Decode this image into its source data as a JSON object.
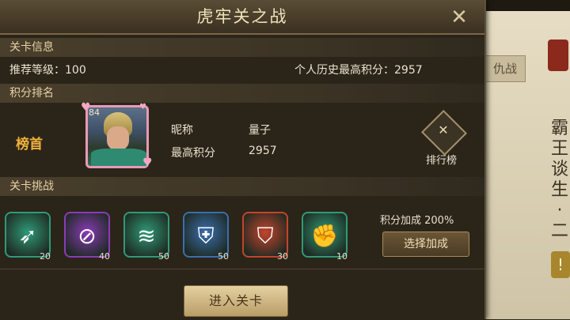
{
  "dialog": {
    "title": "虎牢关之战",
    "close_label": "✕"
  },
  "level_info": {
    "header": "关卡信息",
    "recommended_label": "推荐等级：",
    "recommended_value": "100",
    "personal_best_label": "个人历史最高积分：",
    "personal_best_value": "2957"
  },
  "ranking": {
    "header": "积分排名",
    "top_badge": "榜首",
    "portrait_level": "84",
    "nickname_label": "昵称",
    "nickname_value": "量子",
    "best_label": "最高积分",
    "best_value": "2957",
    "leaderboard_label": "排行榜"
  },
  "challenge": {
    "header": "关卡挑战",
    "skills": [
      {
        "icon": "horn-icon",
        "glyph": "➶",
        "count": "20",
        "color": "#2f9a78"
      },
      {
        "icon": "ban-fire-icon",
        "glyph": "⊘",
        "count": "40",
        "color": "#8a3bb8"
      },
      {
        "icon": "scroll-icon",
        "glyph": "≋",
        "count": "50",
        "color": "#2f9a78"
      },
      {
        "icon": "armor-icon",
        "glyph": "⛨",
        "count": "50",
        "color": "#3a6fb0"
      },
      {
        "icon": "shield-icon",
        "glyph": "⛉",
        "count": "30",
        "color": "#c4442c"
      },
      {
        "icon": "gauntlet-icon",
        "glyph": "✊",
        "count": "10",
        "color": "#2f9a78"
      }
    ],
    "bonus_text": "积分加成 200%",
    "choose_bonus_label": "选择加成"
  },
  "footer": {
    "enter_label": "进入关卡"
  },
  "background": {
    "tab_label": "仇战",
    "vertical_text": "霸王谈生·二"
  }
}
